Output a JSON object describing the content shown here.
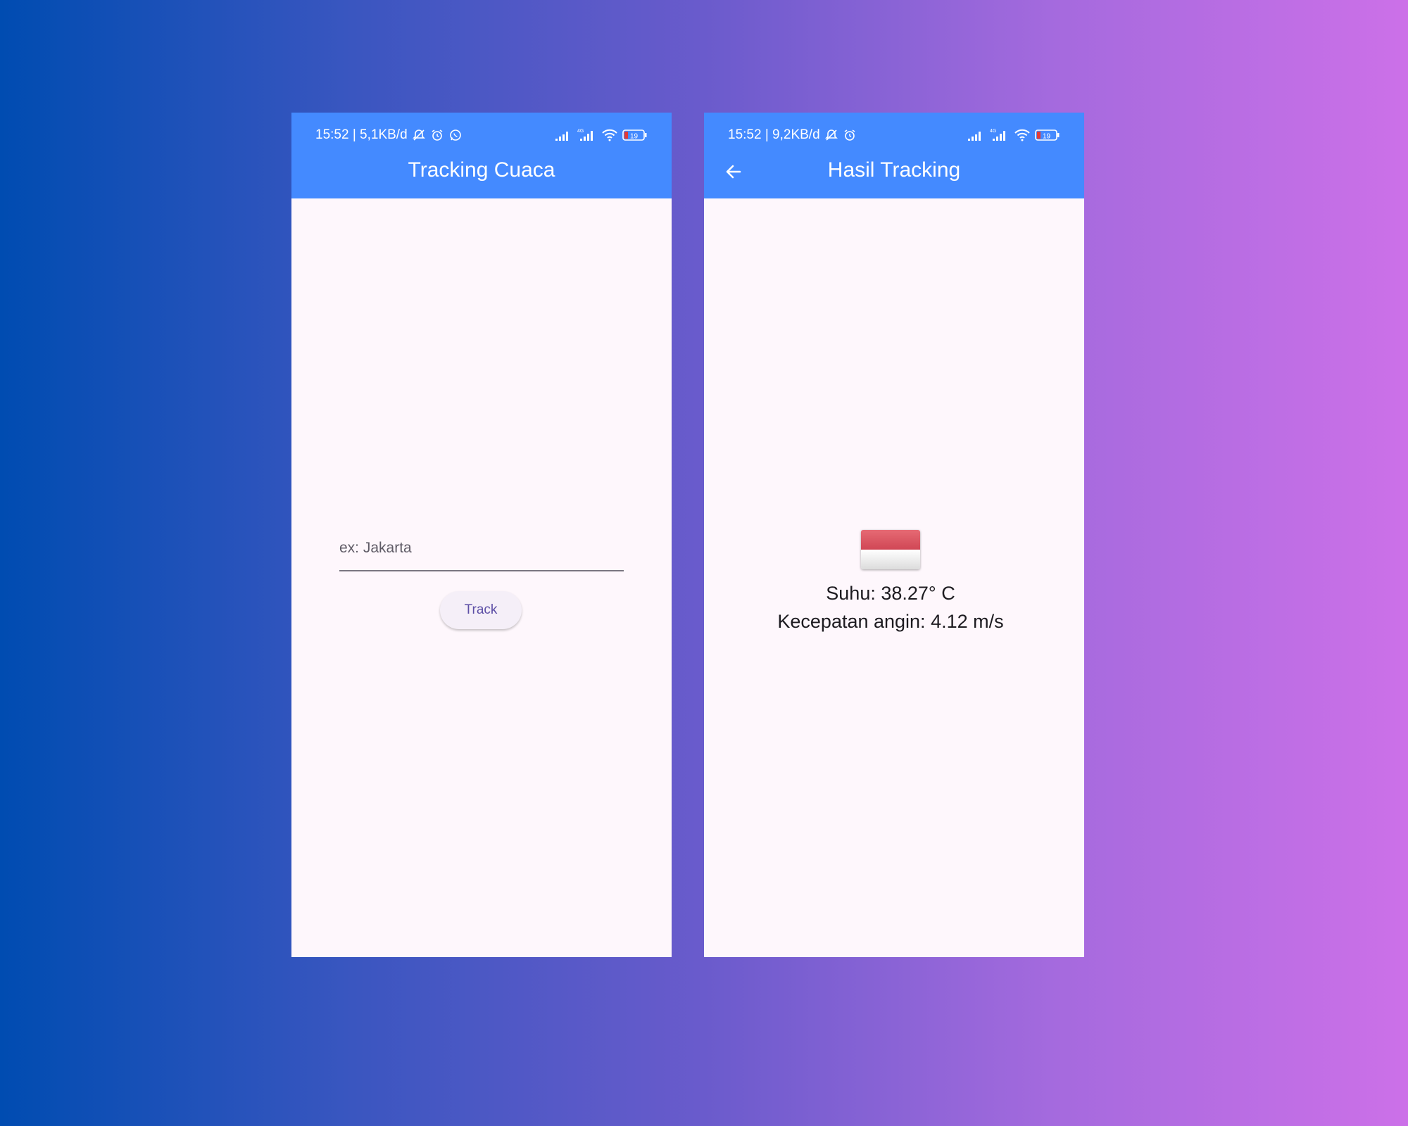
{
  "screens": [
    {
      "status": {
        "time_data": "15:52 | 5,1KB/d",
        "battery": "19",
        "network": "4G"
      },
      "appbar": {
        "title": "Tracking Cuaca"
      },
      "input": {
        "placeholder": "ex: Jakarta",
        "value": ""
      },
      "track_button": {
        "label": "Track"
      }
    },
    {
      "status": {
        "time_data": "15:52 | 9,2KB/d",
        "battery": "19",
        "network": "4G"
      },
      "appbar": {
        "title": "Hasil Tracking"
      },
      "result": {
        "temperature": "Suhu: 38.27° C",
        "wind_speed": "Kecepatan angin: 4.12 m/s",
        "flag_icon": "indonesia-flag"
      }
    }
  ],
  "colors": {
    "appbar": "#448aff",
    "screen_background": "#fef7fc",
    "button_text": "#5d4fa6",
    "background_gradient": [
      "#004cb1",
      "#cc70e8"
    ]
  }
}
